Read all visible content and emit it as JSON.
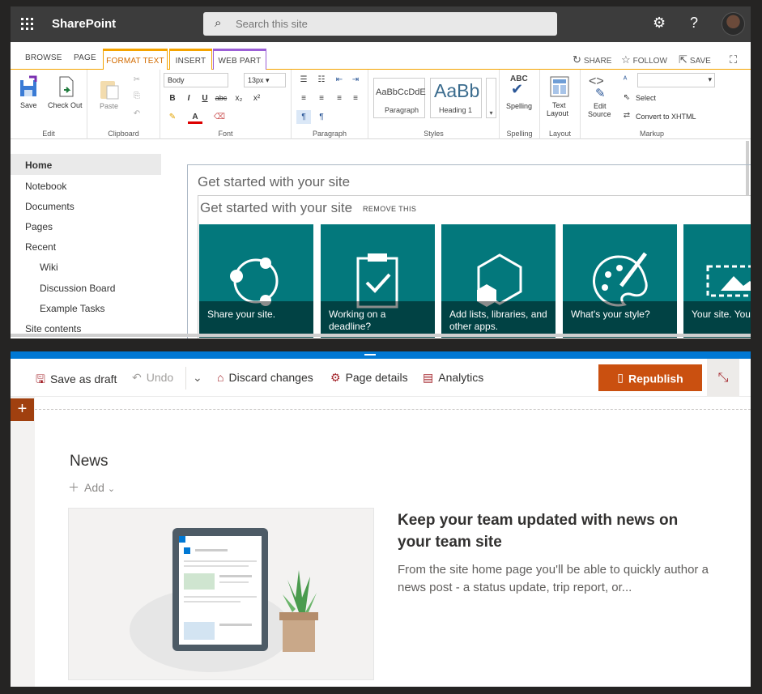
{
  "suitebar": {
    "app_name": "SharePoint",
    "search_placeholder": "Search this site",
    "settings_icon": "gear-icon",
    "help_label": "?"
  },
  "ribbon_tabs": {
    "browse": "BROWSE",
    "page": "PAGE",
    "format_text": "FORMAT TEXT",
    "insert": "INSERT",
    "web_part": "WEB PART",
    "share": "SHARE",
    "follow": "FOLLOW",
    "save": "SAVE"
  },
  "ribbon": {
    "edit": {
      "save": "Save",
      "check_out": "Check Out",
      "group": "Edit"
    },
    "clipboard": {
      "paste": "Paste",
      "group": "Clipboard"
    },
    "font": {
      "style_value": "Body",
      "size_value": "13px",
      "bold": "B",
      "italic": "I",
      "underline": "U",
      "strike": "abc",
      "sub": "x₂",
      "sup": "x²",
      "group": "Font"
    },
    "paragraph": {
      "group": "Paragraph"
    },
    "styles": {
      "style1_preview": "AaBbCcDdE",
      "style1_label": "Paragraph",
      "style2_preview": "AaBb",
      "style2_label": "Heading 1",
      "group": "Styles"
    },
    "spelling": {
      "abc": "ABC",
      "label": "Spelling",
      "group": "Spelling"
    },
    "layout": {
      "label1": "Text",
      "label2": "Layout",
      "group": "Layout"
    },
    "markup": {
      "edit1": "Edit",
      "edit2": "Source",
      "select": "Select",
      "convert": "Convert to XHTML",
      "group": "Markup"
    }
  },
  "leftnav": {
    "items": [
      "Home",
      "Notebook",
      "Documents",
      "Pages",
      "Recent"
    ],
    "recent": [
      "Wiki",
      "Discussion Board",
      "Example Tasks"
    ],
    "site_contents": "Site contents"
  },
  "getstarted": {
    "title": "Get started with your site",
    "inner_title": "Get started with your site",
    "remove": "REMOVE THIS",
    "tiles": [
      {
        "label": "Share your site.",
        "icon": "share-icon"
      },
      {
        "label": "Working on a deadline?",
        "icon": "clipboard-check-icon"
      },
      {
        "label": "Add lists, libraries, and other apps.",
        "icon": "apps-icon"
      },
      {
        "label": "What's your style?",
        "icon": "palette-icon"
      },
      {
        "label": "Your site. Your",
        "icon": "image-icon"
      }
    ]
  },
  "commandbar": {
    "save_draft": "Save as draft",
    "undo": "Undo",
    "discard": "Discard changes",
    "page_details": "Page details",
    "analytics": "Analytics",
    "republish": "Republish"
  },
  "news": {
    "title": "News",
    "add": "Add",
    "headline": "Keep your team updated with news on your team site",
    "body": "From the site home page you'll be able to quickly author a news post - a status update, trip report, or..."
  },
  "colors": {
    "teal": "#03787c",
    "orange": "#ca5010",
    "blue": "#0078d4"
  }
}
